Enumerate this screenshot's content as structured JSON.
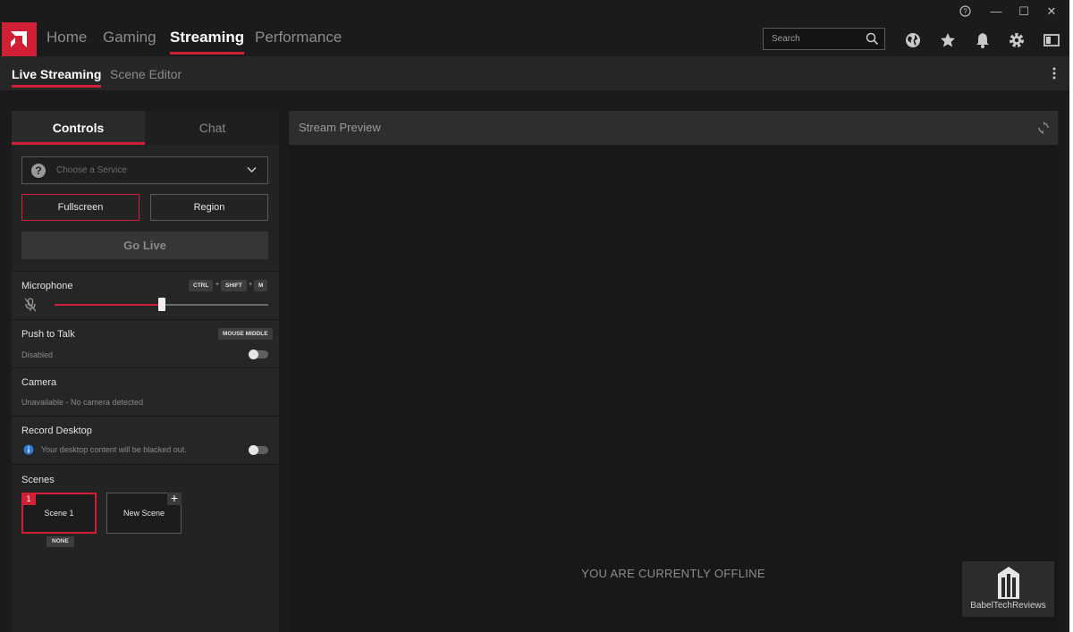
{
  "colors": {
    "accent": "#d11f35",
    "background": "#1b1b1b",
    "panel": "#232323"
  },
  "window_controls": {
    "help": "?",
    "minimize": "—",
    "maximize": "☐",
    "close": "✕"
  },
  "top_nav": {
    "tabs": [
      "Home",
      "Gaming",
      "Streaming",
      "Performance"
    ],
    "active": "Streaming",
    "search_placeholder": "Search",
    "icons": [
      "globe-icon",
      "star-icon",
      "bell-icon",
      "gear-icon",
      "sidebar-icon"
    ]
  },
  "sub_nav": {
    "tabs": [
      "Live Streaming",
      "Scene Editor"
    ],
    "active": "Live Streaming"
  },
  "controls": {
    "tabs": [
      "Controls",
      "Chat"
    ],
    "service_placeholder": "Choose a Service",
    "mode_buttons": [
      "Fullscreen",
      "Region"
    ],
    "go_live": "Go Live",
    "microphone": {
      "label": "Microphone",
      "keys": [
        "CTRL",
        "SHIFT",
        "M"
      ],
      "plus": "+",
      "volume": 0.5
    },
    "push_to_talk": {
      "label": "Push to Talk",
      "key": "MOUSE MIDDLE",
      "status": "Disabled"
    },
    "camera": {
      "label": "Camera",
      "status": "Unavailable - No camera detected"
    },
    "record_desktop": {
      "label": "Record Desktop",
      "info": "Your desktop content will be blacked out."
    },
    "scenes": {
      "label": "Scenes",
      "items": [
        {
          "number": "1",
          "name": "Scene 1",
          "badge": "NONE"
        },
        {
          "name": "New Scene",
          "add": "+"
        }
      ]
    }
  },
  "preview": {
    "title": "Stream Preview",
    "status": "YOU ARE CURRENTLY OFFLINE",
    "watermark": "BabelTechReviews"
  }
}
